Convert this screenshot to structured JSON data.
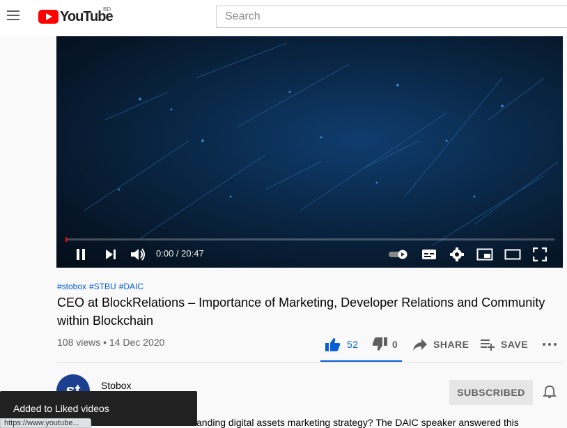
{
  "header": {
    "logo_text": "YouTube",
    "region": "BD",
    "search_placeholder": "Search"
  },
  "player": {
    "time": "0:00 / 20:47",
    "progress_fraction": 0.0
  },
  "video": {
    "hashtags": [
      "#stobox",
      "#STBU",
      "#DAIC"
    ],
    "title": "CEO at BlockRelations – Importance of Marketing, Developer Relations and Community within Blockchain",
    "meta": "108 views • 14 Dec 2020",
    "likes": "52",
    "dislikes": "0",
    "share_label": "SHARE",
    "save_label": "SAVE"
  },
  "channel": {
    "name": "Stobox",
    "avatar_text": "st",
    "subscribe_label": "SUBSCRIBED"
  },
  "description_snippet": "anding digital assets marketing strategy? The DAIC speaker answered this",
  "toast": "Added to Liked videos",
  "status_url": "https://www.youtube...",
  "colors": {
    "accent_blue": "#065fd4",
    "brand_red": "#ff0000",
    "avatar_bg": "#1d3f8f"
  }
}
